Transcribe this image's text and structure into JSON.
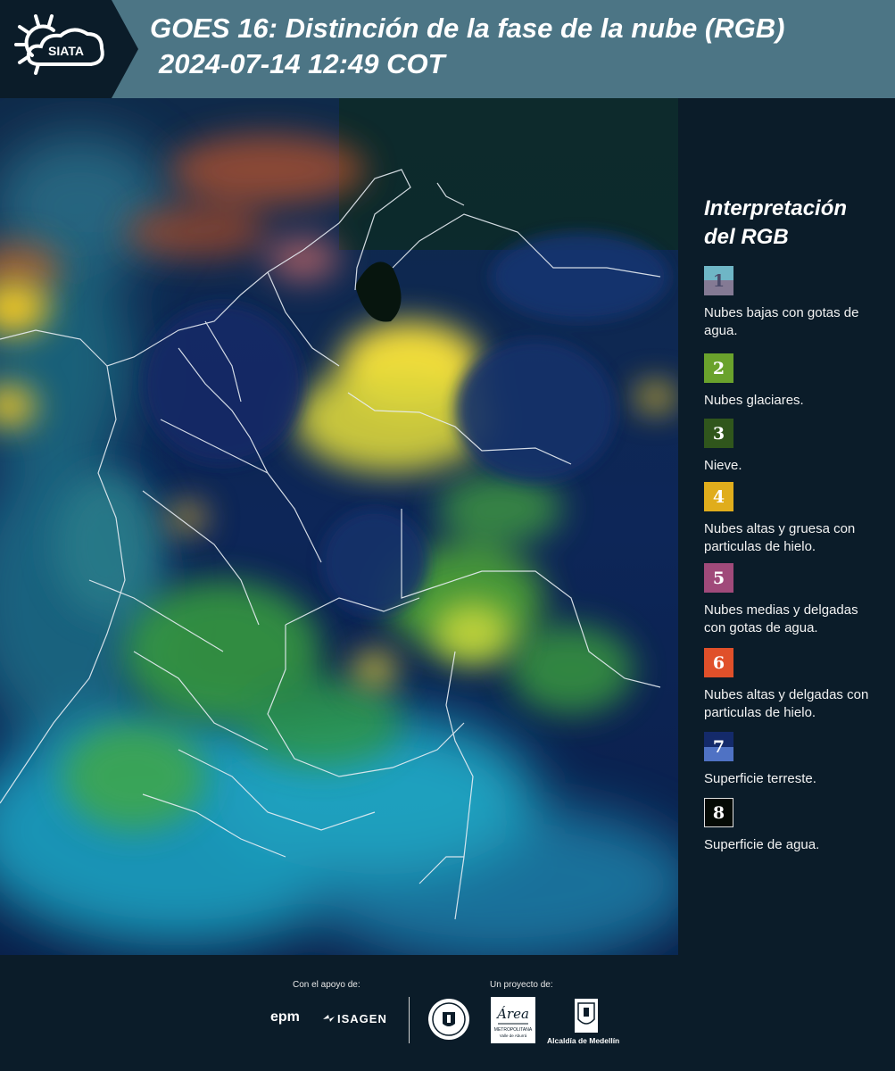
{
  "header": {
    "logo_text": "SIATA",
    "title": "GOES 16: Distinción de la fase de la nube (RGB)",
    "datetime": "2024-07-14 12:49 COT"
  },
  "legend": {
    "title_line1": "Interpretación",
    "title_line2": "del RGB",
    "items": [
      {
        "number": "1",
        "label": "Nubes bajas con gotas de agua.",
        "color_top": "#6fb6c6",
        "color_bottom": "#847a94"
      },
      {
        "number": "2",
        "label": "Nubes glaciares.",
        "color_top": "#6aa22c",
        "color_bottom": "#6aa22c"
      },
      {
        "number": "3",
        "label": "Nieve.",
        "color_top": "#30561c",
        "color_bottom": "#30561c"
      },
      {
        "number": "4",
        "label": "Nubes altas y gruesa con particulas de hielo.",
        "color_top": "#e0ad1c",
        "color_bottom": "#e0ad1c"
      },
      {
        "number": "5",
        "label": "Nubes medias y delgadas con gotas de agua.",
        "color_top": "#a04a7a",
        "color_bottom": "#a04a7a"
      },
      {
        "number": "6",
        "label": "Nubes altas y delgadas con particulas de hielo.",
        "color_top": "#e0502a",
        "color_bottom": "#e0502a"
      },
      {
        "number": "7",
        "label": "Superficie terreste.",
        "color_top": "#142a6a",
        "color_bottom": "#4f72c4"
      },
      {
        "number": "8",
        "label": "Superficie de agua.",
        "color_top": "#050a05",
        "color_bottom": "#050a05"
      }
    ]
  },
  "footer": {
    "support_label": "Con el apoyo de:",
    "project_label": "Un proyecto de:",
    "epm": "epm",
    "isagen": "ISAGEN",
    "area_logo_text": "Área",
    "area_sub1": "METROPOLITANA",
    "area_sub2": "Valle de Aburrá",
    "alcaldia": "Alcaldía de Medellín"
  },
  "colors": {
    "background": "#0b1c29",
    "header": "#4c7585",
    "ocean": "#0b2452"
  }
}
